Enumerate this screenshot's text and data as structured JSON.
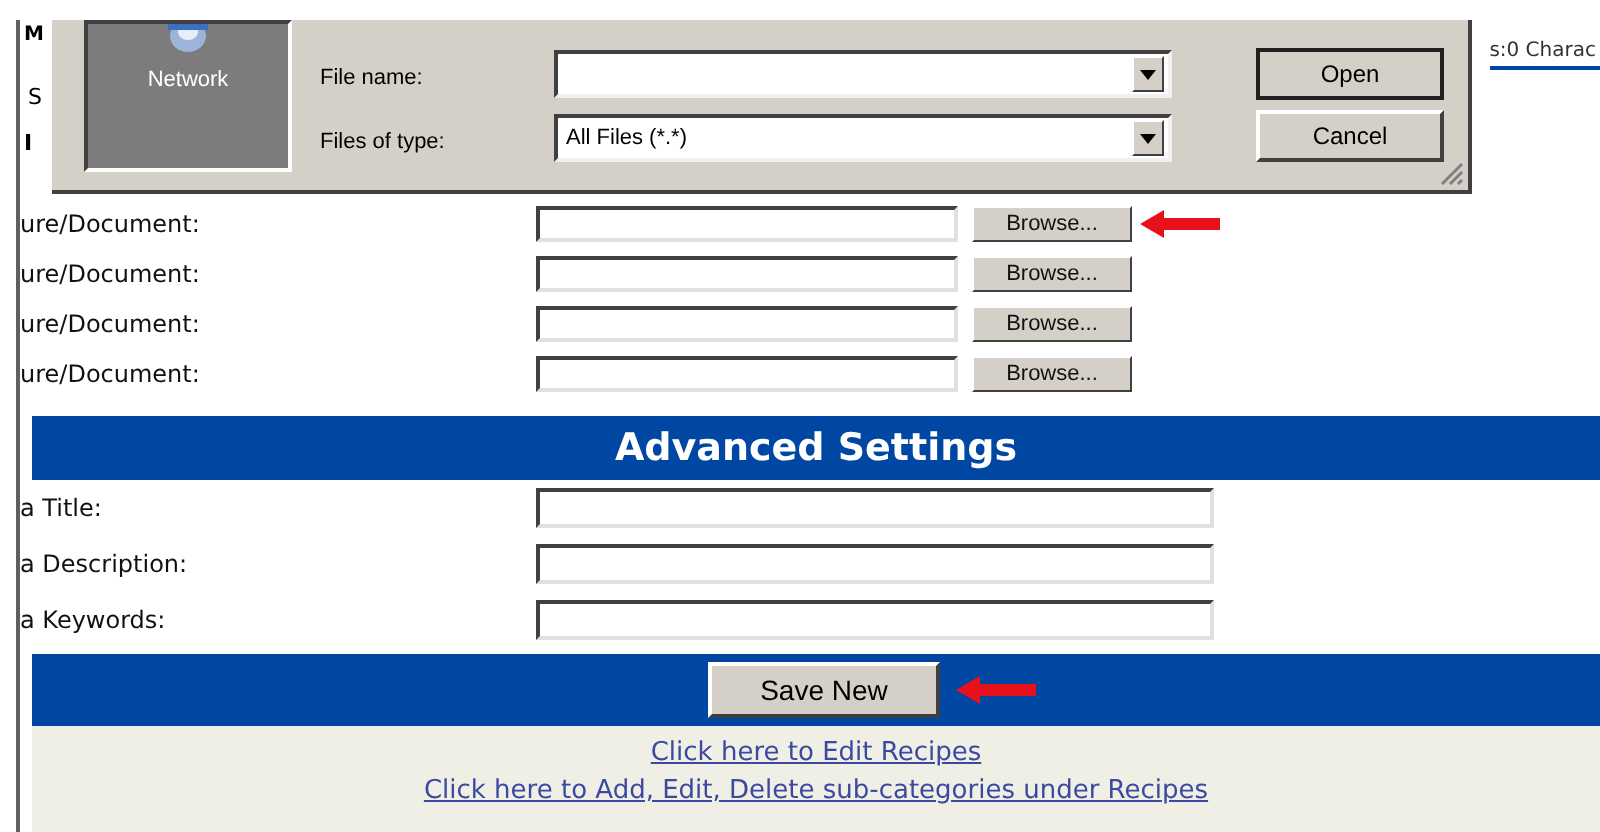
{
  "background_page": {
    "fragments": [
      "M",
      "S",
      "I"
    ],
    "status_fragment": "s:0 Charac"
  },
  "file_rows": [
    {
      "label": "ure/Document:",
      "button": "Browse...",
      "arrow": true
    },
    {
      "label": "ure/Document:",
      "button": "Browse...",
      "arrow": false
    },
    {
      "label": "ure/Document:",
      "button": "Browse...",
      "arrow": false
    },
    {
      "label": "ure/Document:",
      "button": "Browse...",
      "arrow": false
    }
  ],
  "advanced_header": "Advanced Settings",
  "meta_rows": [
    {
      "label": "a Title:"
    },
    {
      "label": "a Description:"
    },
    {
      "label": "a Keywords:"
    }
  ],
  "save_button": {
    "label": "Save New",
    "arrow": true
  },
  "links": [
    "Click here to Edit Recipes",
    "Click here to Add, Edit, Delete sub-categories under Recipes"
  ],
  "dialog": {
    "place": "Network",
    "file_name_label": "File name:",
    "type_label": "Files of type:",
    "type_value": "All Files (*.*)",
    "buttons": [
      "Open",
      "Cancel"
    ]
  }
}
